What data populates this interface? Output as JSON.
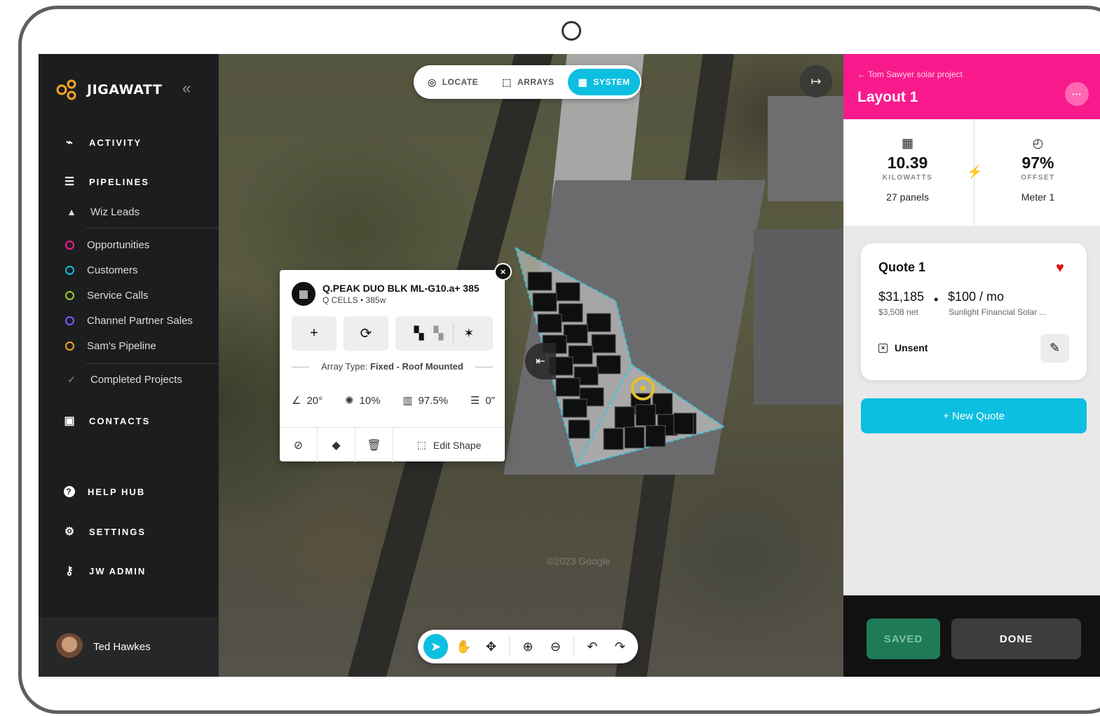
{
  "app": {
    "name": "JIGAWATT"
  },
  "sidebar": {
    "collapse_label": "«",
    "main_items": [
      {
        "label": "ACTIVITY",
        "icon": "activity-icon"
      },
      {
        "label": "PIPELINES",
        "icon": "pipelines-icon"
      }
    ],
    "pipeline_items": [
      {
        "label": "Wiz Leads",
        "icon": "wizard-icon"
      },
      {
        "label": "Opportunities",
        "color": "#f81a8c"
      },
      {
        "label": "Customers",
        "color": "#0cbfe0"
      },
      {
        "label": "Service Calls",
        "color": "#9acd32"
      },
      {
        "label": "Channel Partner Sales",
        "color": "#7b5cff"
      },
      {
        "label": "Sam's Pipeline",
        "color": "#f5a623"
      },
      {
        "label": "Completed Projects",
        "icon": "check-icon"
      }
    ],
    "contacts": "CONTACTS",
    "help_hub": "HELP HUB",
    "settings": "SETTINGS",
    "jw_admin": "JW ADMIN",
    "user_name": "Ted Hawkes"
  },
  "tabs": [
    {
      "label": "LOCATE",
      "icon": "locate-icon"
    },
    {
      "label": "ARRAYS",
      "icon": "arrays-icon"
    },
    {
      "label": "SYSTEM",
      "icon": "system-icon",
      "active": true
    }
  ],
  "map": {
    "watermark": "©2023 Google"
  },
  "panel": {
    "title": "Q.PEAK DUO BLK ML-G10.a+ 385",
    "subtitle": "Q CELLS • 385w",
    "array_type_label": "Array Type:",
    "array_type_value": "Fixed - Roof Mounted",
    "specs": [
      {
        "icon": "tilt-icon",
        "value": "20°"
      },
      {
        "icon": "shading-icon",
        "value": "10%"
      },
      {
        "icon": "efficiency-icon",
        "value": "97.5%"
      },
      {
        "icon": "setback-icon",
        "value": "0\""
      }
    ],
    "edit_shape": "Edit Shape"
  },
  "right_panel": {
    "back_label": "← Tom Sawyer solar project",
    "title": "Layout 1",
    "stat_left": {
      "value": "10.39",
      "unit": "KILOWATTS",
      "sub": "27 panels"
    },
    "stat_right": {
      "value": "97%",
      "unit": "OFFSET",
      "sub": "Meter 1"
    },
    "quote": {
      "title": "Quote 1",
      "price": "$31,185",
      "net": "$3,508 net",
      "monthly": "$100 / mo",
      "financier": "Sunlight Financial Solar ...",
      "status": "Unsent"
    },
    "new_quote": "+ New Quote",
    "saved": "SAVED",
    "done": "DONE"
  },
  "colors": {
    "accent": "#0cbfe0",
    "brand_pink": "#f81a8c",
    "sidebar": "#1c1d1e",
    "saved_green": "#1f7a57"
  }
}
